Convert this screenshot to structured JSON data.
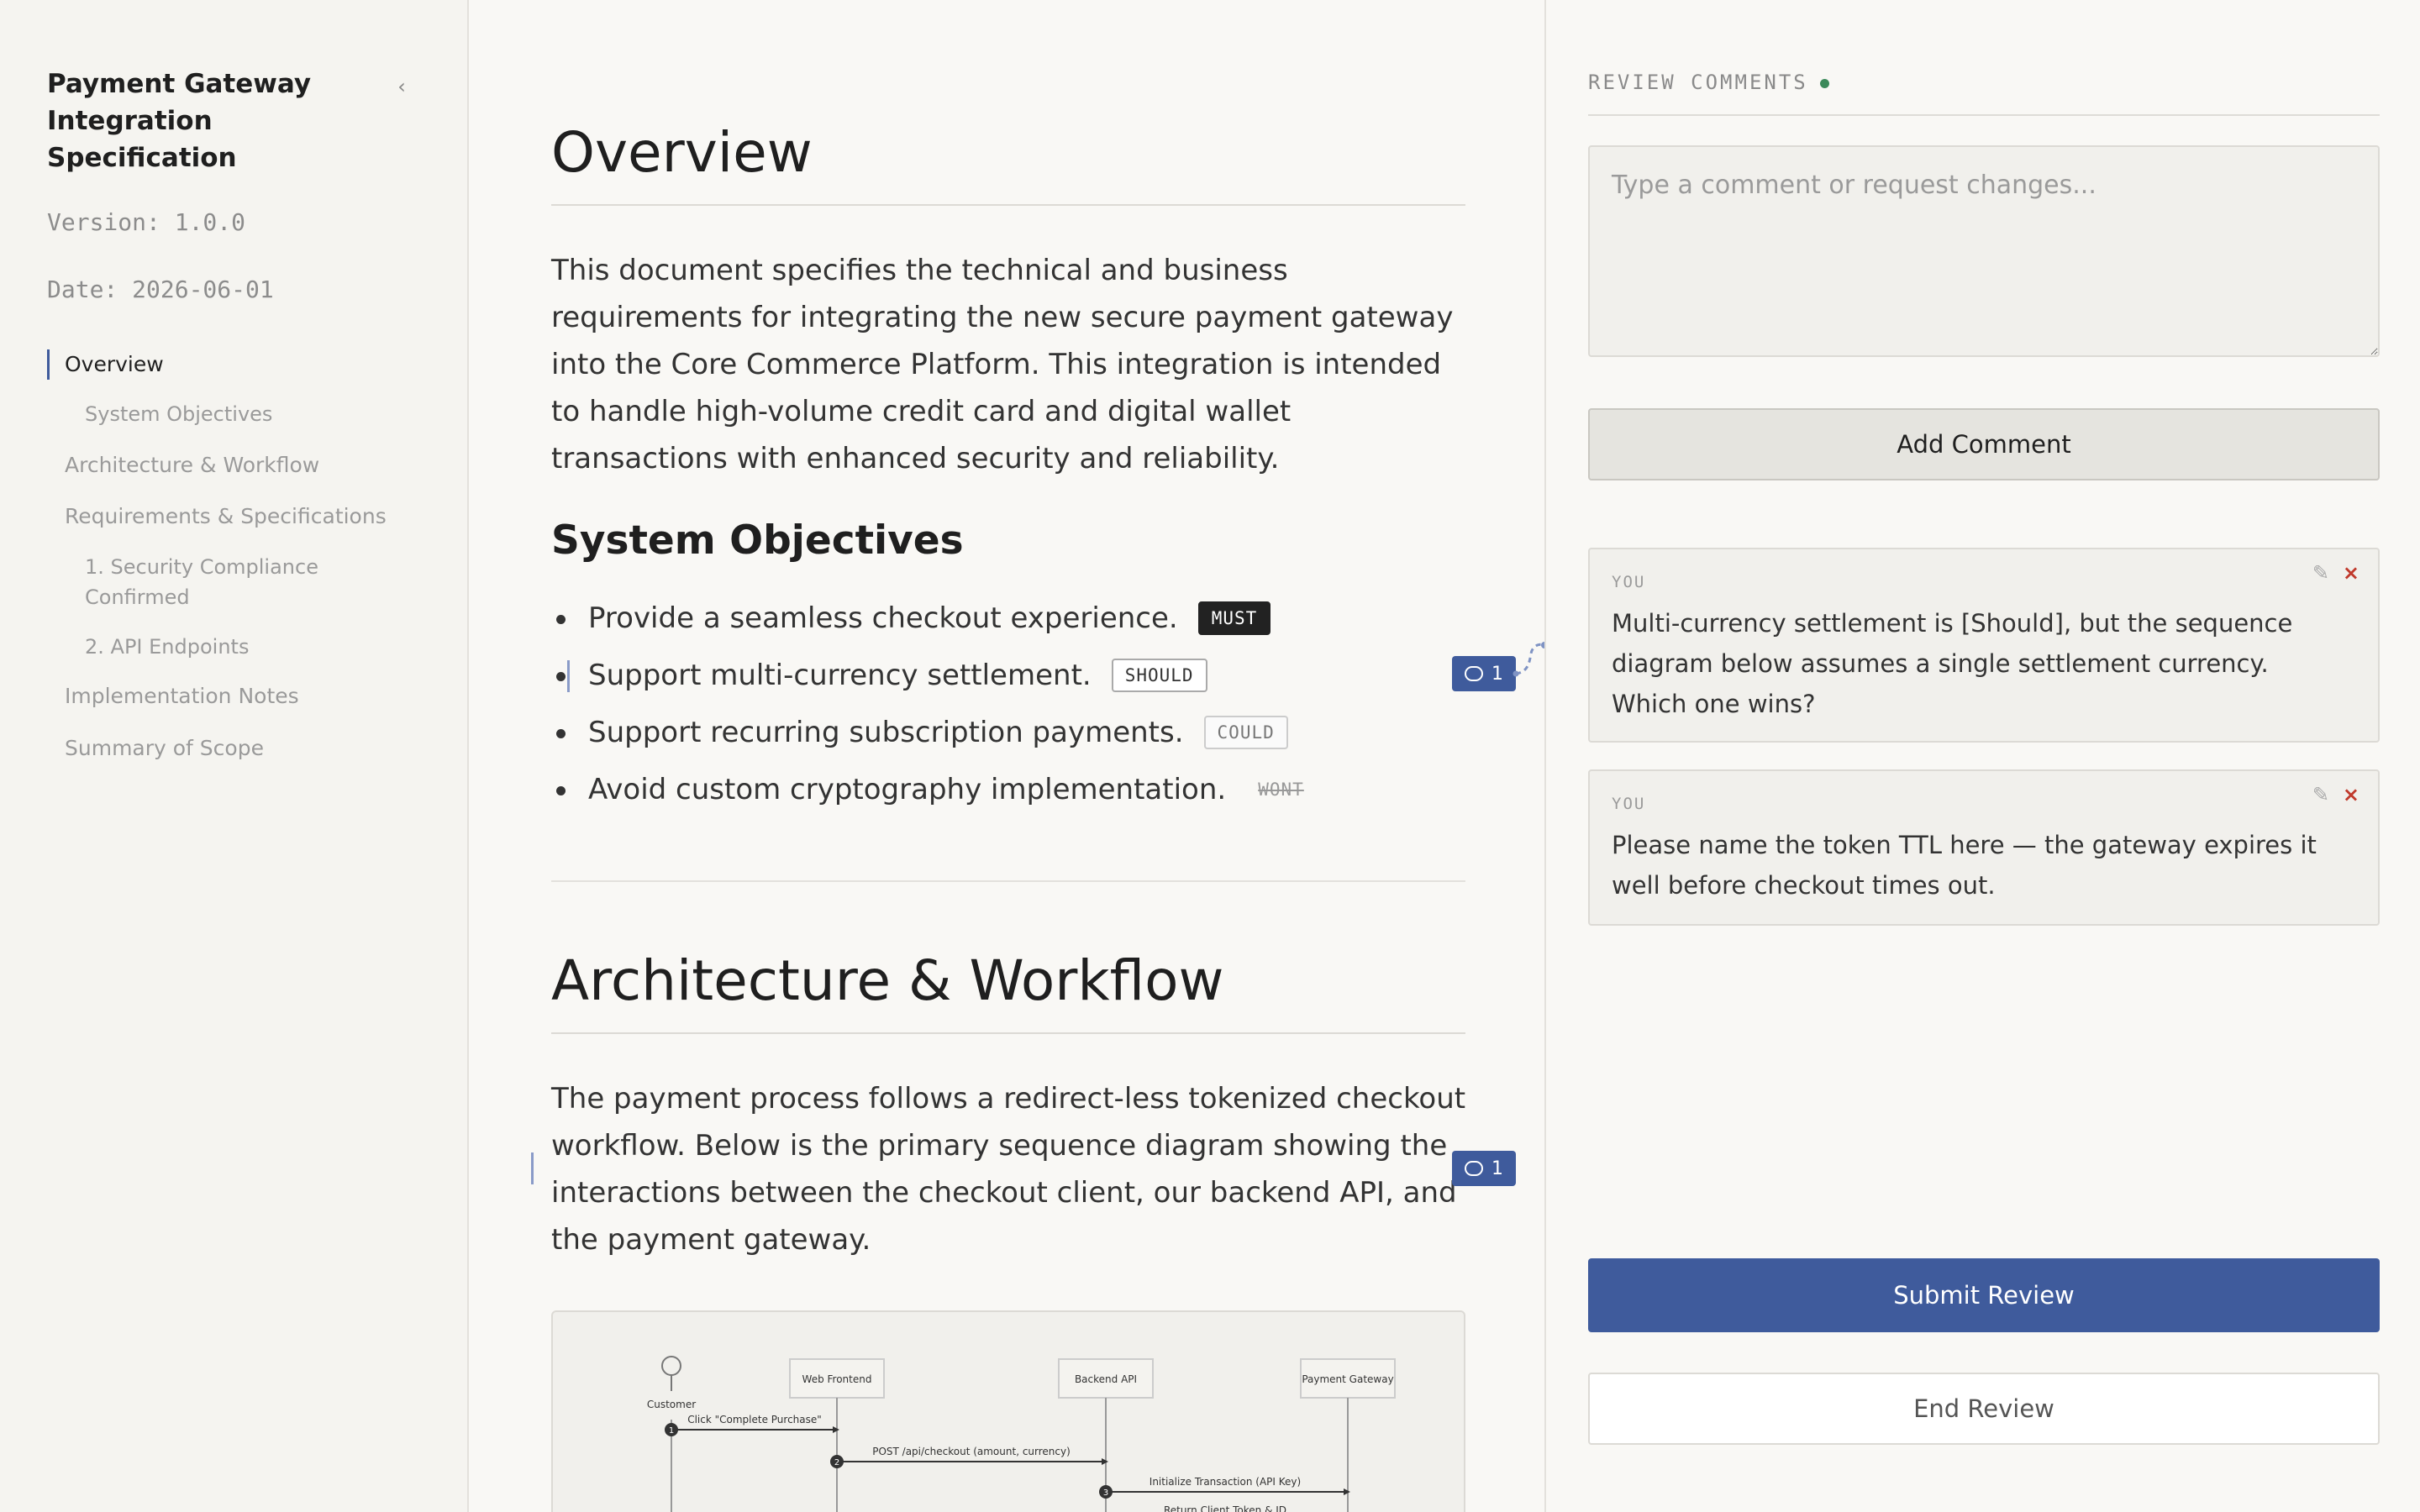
{
  "sidebar": {
    "title": "Payment Gateway Integration Specification",
    "collapse_icon": "‹",
    "version": "Version: 1.0.0",
    "date": "Date: 2026-06-01",
    "toc": [
      {
        "label": "Overview"
      },
      {
        "label": "System Objectives"
      },
      {
        "label": "Architecture & Workflow"
      },
      {
        "label": "Requirements & Specifications"
      },
      {
        "label": "1. Security Compliance Confirmed"
      },
      {
        "label": "2. API Endpoints"
      },
      {
        "label": "Implementation Notes"
      },
      {
        "label": "Summary of Scope"
      }
    ]
  },
  "main": {
    "overview_heading": "Overview",
    "overview_text": "This document specifies the technical and business requirements for integrating the new secure payment gateway into the Core Commerce Platform. This integration is intended to handle high-volume credit card and digital wallet transactions with enhanced security and reliability.",
    "objectives_heading": "System Objectives",
    "objectives": [
      {
        "text": "Provide a seamless checkout experience.",
        "tag": "MUST"
      },
      {
        "text": "Support multi-currency settlement.",
        "tag": "SHOULD"
      },
      {
        "text": "Support recurring subscription payments.",
        "tag": "COULD"
      },
      {
        "text": "Avoid custom cryptography implementation.",
        "tag": "WONT"
      }
    ],
    "architecture_heading": "Architecture & Workflow",
    "architecture_text": "The payment process follows a redirect-less tokenized checkout workflow. Below is the primary sequence diagram showing the interactions between the checkout client, our backend API, and the payment gateway.",
    "badge_1_count": "1",
    "badge_2_count": "1",
    "diagram": {
      "actors": [
        "Customer",
        "Web Frontend",
        "Backend API",
        "Payment Gateway"
      ],
      "messages": [
        "Click \"Complete Purchase\"",
        "POST /api/checkout (amount, currency)",
        "Initialize Transaction (API Key)",
        "Return Client Token & ID"
      ],
      "steps": [
        "1",
        "2",
        "3"
      ]
    }
  },
  "panel": {
    "heading": "REVIEW COMMENTS",
    "comment_placeholder": "Type a comment or request changes...",
    "add_label": "Add Comment",
    "comments": [
      {
        "author": "YOU",
        "text": "Multi-currency settlement is [Should], but the sequence diagram below assumes a single settlement currency. Which one wins?"
      },
      {
        "author": "YOU",
        "text": "Please name the token TTL here — the gateway expires it well before checkout times out."
      }
    ],
    "edit_icon": "✎",
    "delete_icon": "×",
    "submit_label": "Submit Review",
    "end_label": "End Review"
  },
  "colors": {
    "accent": "#3f5b9c",
    "status_dot": "#3c8a5a",
    "delete": "#c0392b"
  }
}
